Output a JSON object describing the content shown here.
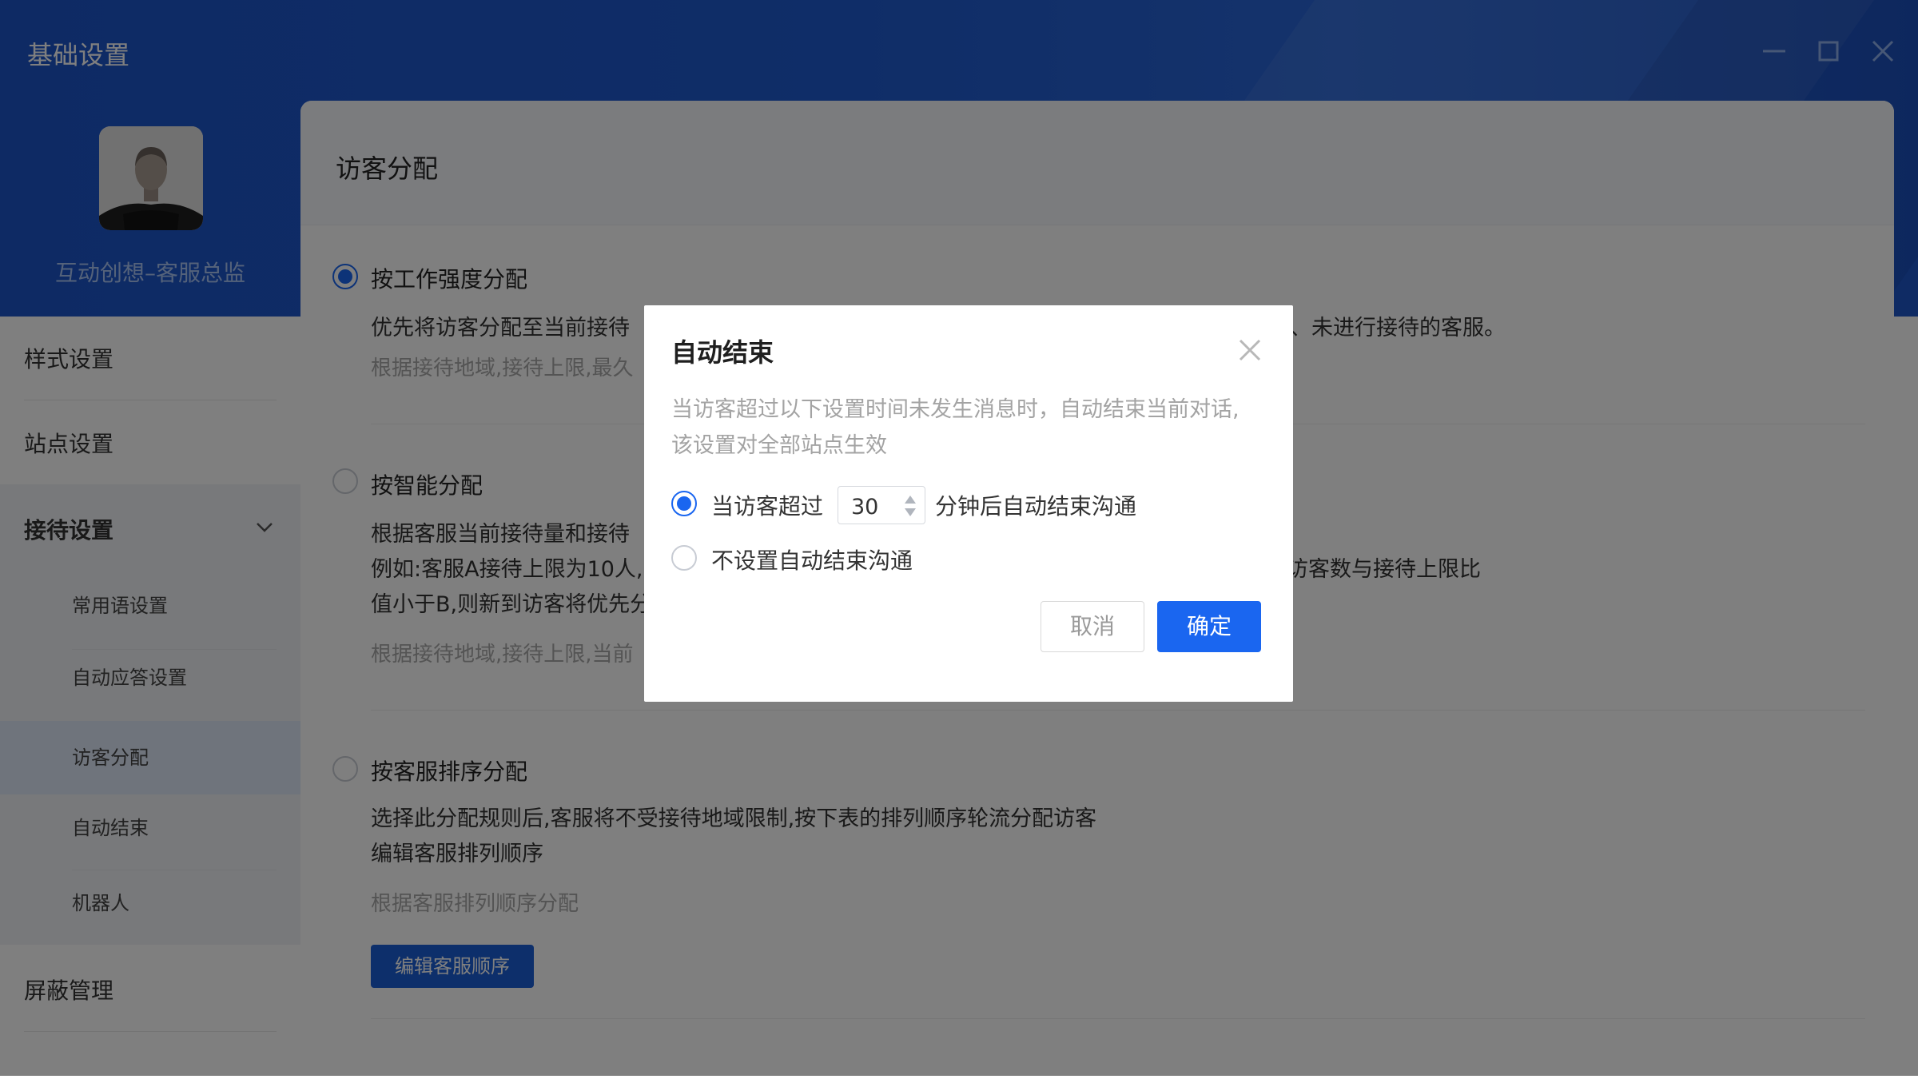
{
  "window": {
    "title": "基础设置",
    "controls": {
      "minimize_icon": "minimize-icon",
      "maximize_icon": "maximize-icon",
      "close_icon": "close-icon"
    }
  },
  "profile": {
    "name": "互动创想–客服总监"
  },
  "sidebar": {
    "items": [
      {
        "label": "样式设置"
      },
      {
        "label": "站点设置"
      },
      {
        "label": "接待设置",
        "expanded": true
      },
      {
        "label": "屏蔽管理"
      }
    ],
    "sub_items": [
      {
        "label": "常用语设置"
      },
      {
        "label": "自动应答设置"
      },
      {
        "label": "访客分配",
        "active": true
      },
      {
        "label": "自动结束"
      },
      {
        "label": "机器人"
      }
    ]
  },
  "main": {
    "title": "访客分配",
    "options": [
      {
        "title": "按工作强度分配",
        "selected": true,
        "desc_left": "优先将访客分配至当前接待",
        "desc_right": "、未进行接待的客服。",
        "hint": "根据接待地域,接待上限,最久"
      },
      {
        "title": "按智能分配",
        "selected": false,
        "desc_line1": "根据客服当前接待量和接待",
        "desc_line2_left": "例如:客服A接待上限为10人,",
        "desc_line2_right": "访客数与接待上限比",
        "desc_line3": "值小于B,则新到访客将优先分",
        "hint": "根据接待地域,接待上限,当前"
      },
      {
        "title": "按客服排序分配",
        "selected": false,
        "desc_line1": "选择此分配规则后,客服将不受接待地域限制,按下表的排列顺序轮流分配访客",
        "desc_line2": "编辑客服排列顺序",
        "hint": "根据客服排列顺序分配",
        "button": "编辑客服顺序"
      }
    ]
  },
  "dialog": {
    "title": "自动结束",
    "desc_line1": "当访客超过以下设置时间未发生消息时，自动结束当前对话,",
    "desc_line2": "该设置对全部站点生效",
    "option1_prefix": "当访客超过",
    "option1_value": "30",
    "option1_suffix": "分钟后自动结束沟通",
    "option1_selected": true,
    "option2_label": "不设置自动结束沟通",
    "option2_selected": false,
    "cancel": "取消",
    "ok": "确定"
  },
  "colors": {
    "header_blue": "#1f5bd0",
    "primary": "#1a66f0",
    "edit_button": "#1a5fd6"
  }
}
